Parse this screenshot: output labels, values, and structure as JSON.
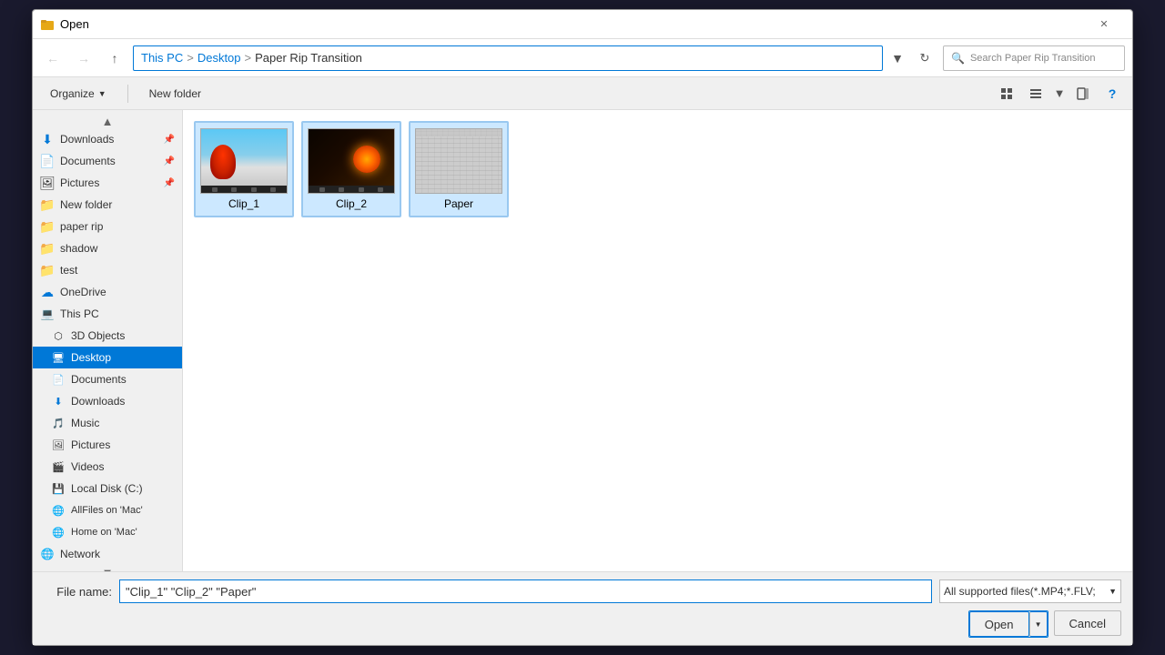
{
  "dialog": {
    "title": "Open",
    "close_label": "✕"
  },
  "address_bar": {
    "breadcrumbs": [
      "This PC",
      "Desktop",
      "Paper Rip Transition"
    ],
    "search_placeholder": "Search Paper Rip Transition"
  },
  "toolbar": {
    "organize_label": "Organize",
    "new_folder_label": "New folder"
  },
  "sidebar": {
    "scroll_up": "▲",
    "scroll_down": "▼",
    "items": [
      {
        "id": "downloads-pinned",
        "label": "Downloads",
        "icon": "⬇",
        "color": "#0078d7",
        "indent": 0,
        "pinned": true
      },
      {
        "id": "documents-pinned",
        "label": "Documents",
        "icon": "📄",
        "color": "#666",
        "indent": 0,
        "pinned": true
      },
      {
        "id": "pictures-pinned",
        "label": "Pictures",
        "icon": "🖼",
        "color": "#666",
        "indent": 0,
        "pinned": true
      },
      {
        "id": "new-folder",
        "label": "New folder",
        "icon": "📁",
        "color": "#e6a817",
        "indent": 0
      },
      {
        "id": "paper-rip",
        "label": "paper rip",
        "icon": "📁",
        "color": "#e6a817",
        "indent": 0
      },
      {
        "id": "shadow",
        "label": "shadow",
        "icon": "📁",
        "color": "#e6a817",
        "indent": 0
      },
      {
        "id": "test",
        "label": "test",
        "icon": "📁",
        "color": "#e6a817",
        "indent": 0
      },
      {
        "id": "onedrive",
        "label": "OneDrive",
        "icon": "☁",
        "color": "#0078d7",
        "indent": 0
      },
      {
        "id": "this-pc",
        "label": "This PC",
        "icon": "💻",
        "color": "#555",
        "indent": 0
      },
      {
        "id": "3d-objects",
        "label": "3D Objects",
        "icon": "⬡",
        "color": "#555",
        "indent": 1
      },
      {
        "id": "desktop",
        "label": "Desktop",
        "icon": "🖥",
        "color": "#555",
        "indent": 1,
        "active": true
      },
      {
        "id": "documents",
        "label": "Documents",
        "icon": "📄",
        "color": "#666",
        "indent": 1
      },
      {
        "id": "downloads",
        "label": "Downloads",
        "icon": "⬇",
        "color": "#0078d7",
        "indent": 1
      },
      {
        "id": "music",
        "label": "Music",
        "icon": "🎵",
        "color": "#555",
        "indent": 1
      },
      {
        "id": "pictures",
        "label": "Pictures",
        "icon": "🖼",
        "color": "#555",
        "indent": 1
      },
      {
        "id": "videos",
        "label": "Videos",
        "icon": "🎬",
        "color": "#555",
        "indent": 1
      },
      {
        "id": "local-disk",
        "label": "Local Disk (C:)",
        "icon": "💾",
        "color": "#555",
        "indent": 1
      },
      {
        "id": "allfiles-mac",
        "label": "AllFiles on 'Mac'",
        "icon": "🌐",
        "color": "#555",
        "indent": 1
      },
      {
        "id": "home-mac",
        "label": "Home on 'Mac'",
        "icon": "🌐",
        "color": "#555",
        "indent": 1
      },
      {
        "id": "network",
        "label": "Network",
        "icon": "🌐",
        "color": "#555",
        "indent": 0
      }
    ]
  },
  "files": [
    {
      "id": "clip1",
      "name": "Clip_1",
      "type": "video"
    },
    {
      "id": "clip2",
      "name": "Clip_2",
      "type": "video"
    },
    {
      "id": "paper",
      "name": "Paper",
      "type": "image"
    }
  ],
  "bottom": {
    "file_name_label": "File name:",
    "file_name_value": "\"Clip_1\" \"Clip_2\" \"Paper\"",
    "file_type_value": "All supported files(*.MP4;*.FLV;",
    "open_label": "Open",
    "cancel_label": "Cancel"
  }
}
